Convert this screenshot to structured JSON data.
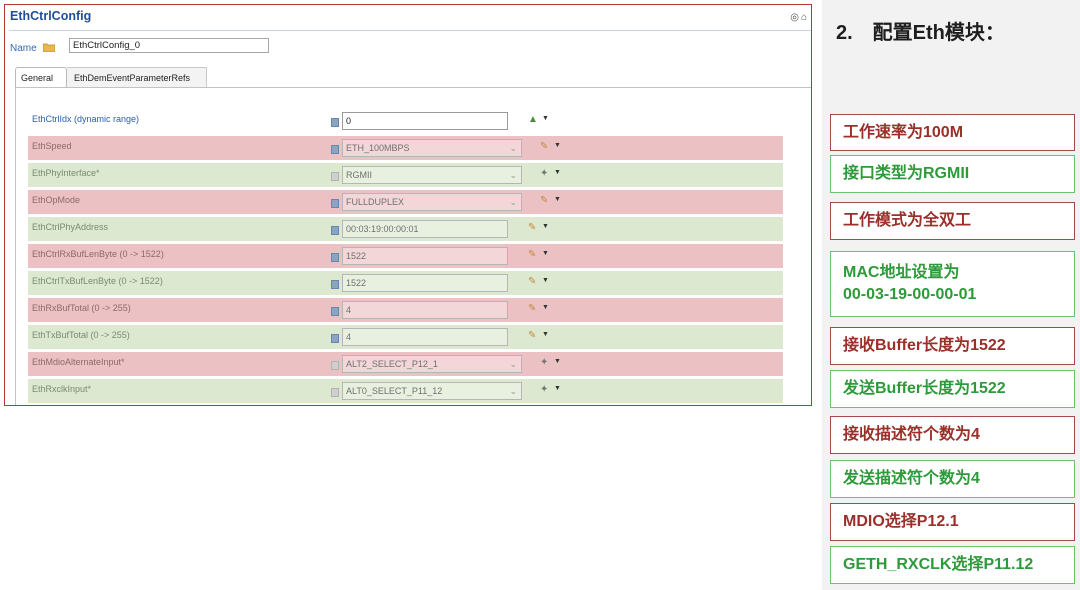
{
  "panel": {
    "title": "EthCtrlConfig",
    "name_label": "Name",
    "name_value": "EthCtrlConfig_0",
    "tabs": [
      "General",
      "EthDemEventParameterRefs"
    ],
    "rows": [
      {
        "label": "EthCtrlIdx (dynamic range)",
        "value": "0"
      },
      {
        "label": "EthSpeed",
        "value": "ETH_100MBPS"
      },
      {
        "label": "EthPhyInterface*",
        "value": "RGMII"
      },
      {
        "label": "EthOpMode",
        "value": "FULLDUPLEX"
      },
      {
        "label": "EthCtrlPhyAddress",
        "value": "00:03:19:00:00:01"
      },
      {
        "label": "EthCtrlRxBufLenByte (0 -> 1522)",
        "value": "1522"
      },
      {
        "label": "EthCtrlTxBufLenByte (0 -> 1522)",
        "value": "1522"
      },
      {
        "label": "EthRxBufTotal (0 -> 255)",
        "value": "4"
      },
      {
        "label": "EthTxBufTotal (0 -> 255)",
        "value": "4"
      },
      {
        "label": "EthMdioAlternateInput*",
        "value": "ALT2_SELECT_P12_1"
      },
      {
        "label": "EthRxclkInput*",
        "value": "ALT0_SELECT_P11_12"
      }
    ]
  },
  "step_title": "2.　配置Eth模块：",
  "annotations": [
    {
      "text": "工作速率为100M"
    },
    {
      "text": "接口类型为RGMII"
    },
    {
      "text": "工作模式为全双工"
    },
    {
      "line1": "MAC地址设置为",
      "line2": "00-03-19-00-00-01"
    },
    {
      "text": "接收Buffer长度为1522"
    },
    {
      "text": "发送Buffer长度为1522"
    },
    {
      "text": "接收描述符个数为4"
    },
    {
      "text": "发送描述符个数为4"
    },
    {
      "text": "MDIO选择P12.1"
    },
    {
      "text": "GETH_RXCLK选择P11.12"
    }
  ],
  "colors": {
    "annotation_red": "#9b2f2a",
    "annotation_green": "#2e9a3a",
    "row_red": "#ecc1c3",
    "row_green": "#dce8cf",
    "title_blue": "#1f4e9c"
  },
  "icons": [
    "folder-icon",
    "file-icon",
    "pencil-icon",
    "wrench-icon",
    "chart-icon",
    "dropdown-arrow-icon",
    "help-icon",
    "home-icon"
  ]
}
